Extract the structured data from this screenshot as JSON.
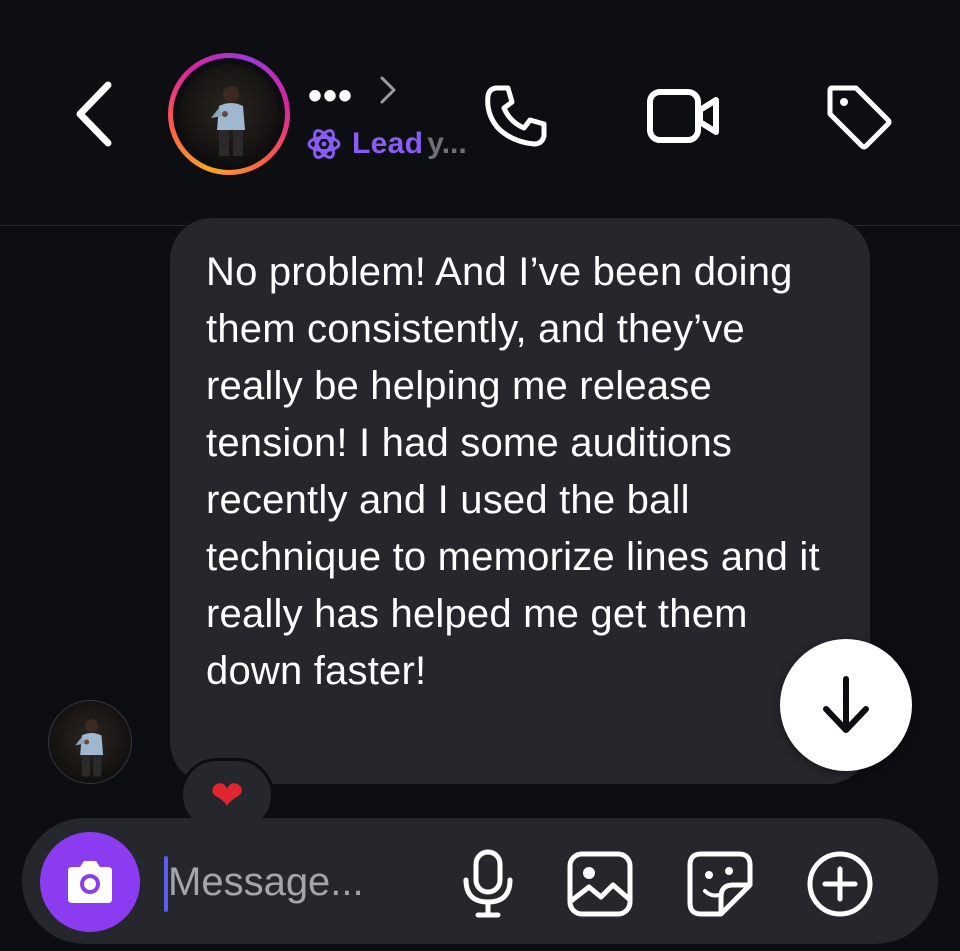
{
  "header": {
    "name_label": "•••",
    "subtitle_label": "Lead",
    "subtitle_tail": "y..."
  },
  "message": {
    "text": "No problem! And I’ve been doing them consistently, and they’ve really be helping me release tension! I had some auditions recently and I used the ball technique to memorize lines and it really has helped me get them down faster!",
    "reaction": "❤"
  },
  "composer": {
    "placeholder": "Message..."
  },
  "icons": {
    "back": "chevron-left-icon",
    "profile_chevron": "chevron-right-icon",
    "subtitle": "atom-icon",
    "phone": "phone-icon",
    "video": "video-camera-icon",
    "tag": "tag-icon",
    "scroll": "arrow-down-icon",
    "camera": "camera-icon",
    "mic": "microphone-icon",
    "gallery": "image-icon",
    "sticker": "sticker-icon",
    "plus": "plus-circle-icon"
  },
  "colors": {
    "background": "#0c0e12",
    "bubble": "#25272d",
    "accent_purple": "#8b3cf0",
    "label_purple": "#8a5cf6"
  }
}
